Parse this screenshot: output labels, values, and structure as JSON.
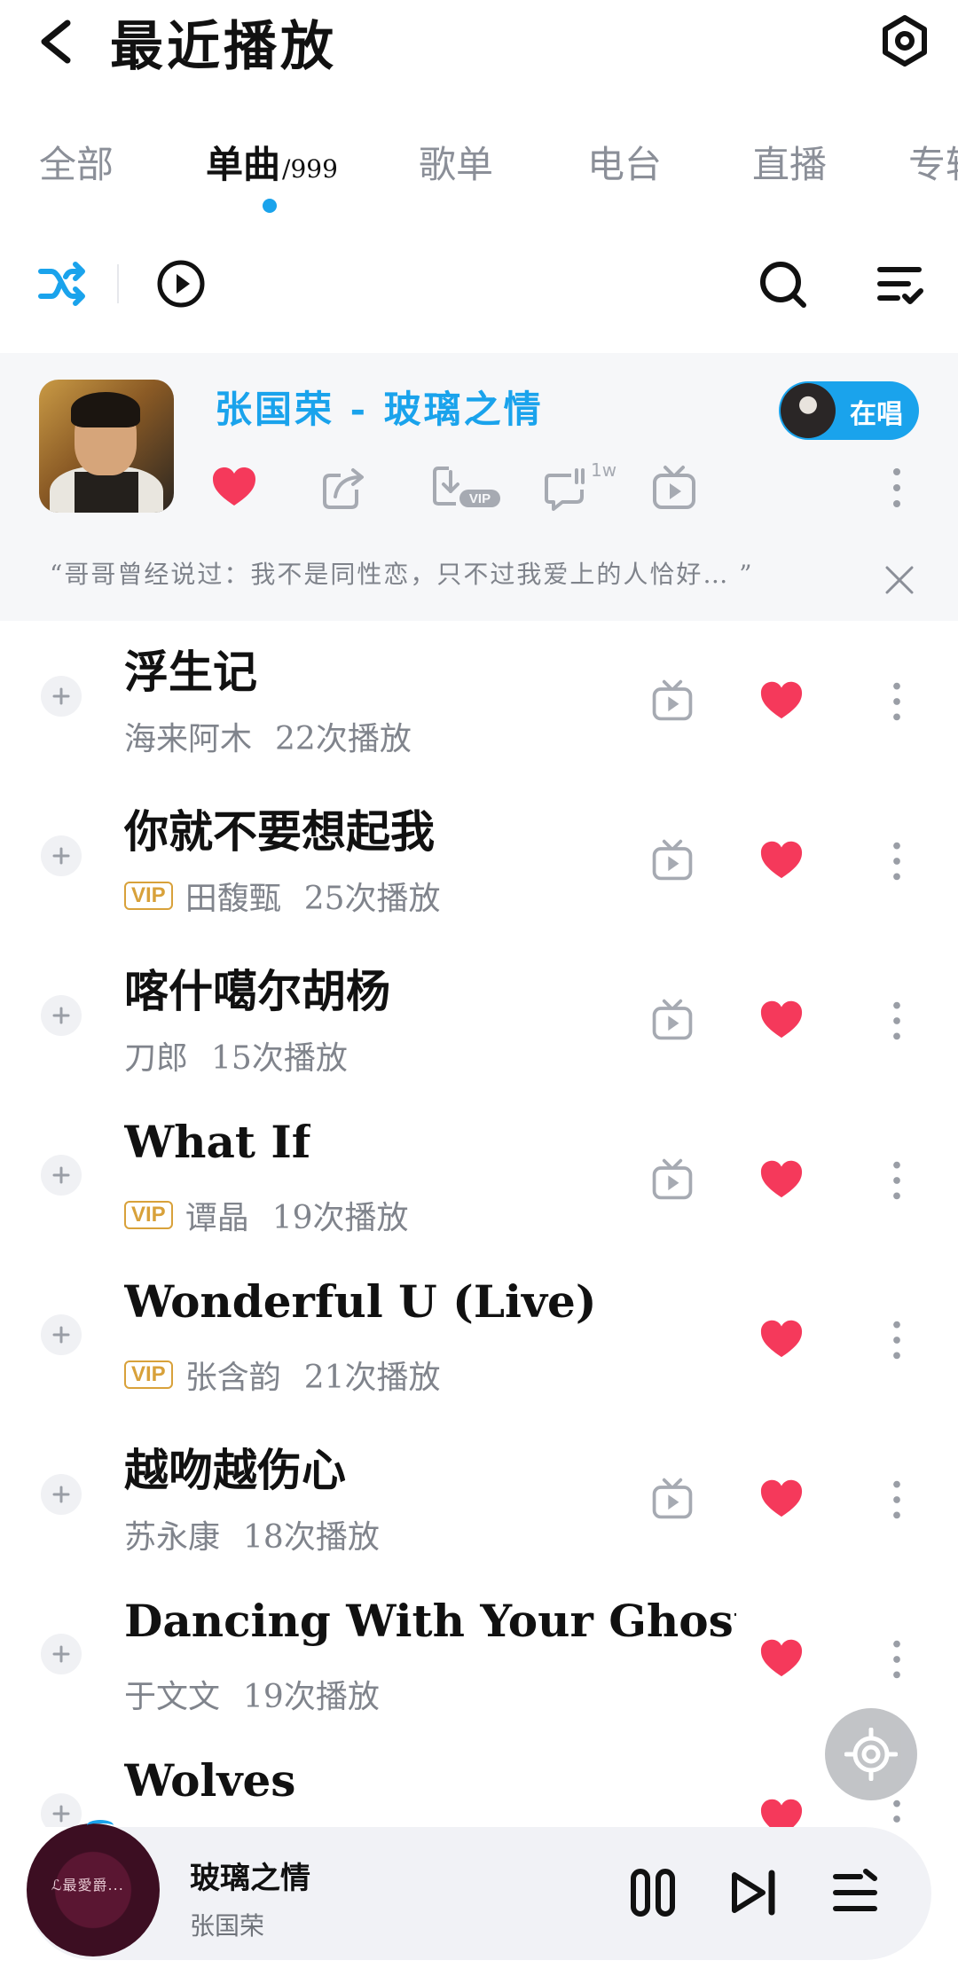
{
  "header": {
    "title": "最近播放"
  },
  "tabs": [
    {
      "label": "全部",
      "sub": ""
    },
    {
      "label": "单曲",
      "sub": "/999"
    },
    {
      "label": "歌单",
      "sub": ""
    },
    {
      "label": "电台",
      "sub": ""
    },
    {
      "label": "直播",
      "sub": ""
    },
    {
      "label": "专辑",
      "sub": ""
    }
  ],
  "now_playing": {
    "title": "张国荣 - 玻璃之情",
    "sing_label": "在唱",
    "quote": "“哥哥曾经说过：我不是同性恋，只不过我爱上的人恰好…  ”",
    "comment_count": "1w"
  },
  "songs": [
    {
      "title": "浮生记",
      "vip": "",
      "artist": "海来阿木",
      "plays": "22次播放",
      "has_mv": true
    },
    {
      "title": "你就不要想起我",
      "vip": "VIP",
      "artist": "田馥甄",
      "plays": "25次播放",
      "has_mv": true
    },
    {
      "title": "喀什噶尔胡杨",
      "vip": "",
      "artist": "刀郎",
      "plays": "15次播放",
      "has_mv": true
    },
    {
      "title": "What If",
      "vip": "VIP",
      "artist": "谭晶",
      "plays": "19次播放",
      "has_mv": true
    },
    {
      "title": "Wonderful U (Live)",
      "vip": "VIP",
      "artist": "张含韵",
      "plays": "21次播放",
      "has_mv": false
    },
    {
      "title": "越吻越伤心",
      "vip": "",
      "artist": "苏永康",
      "plays": "18次播放",
      "has_mv": true
    },
    {
      "title": "Dancing With Your Ghost (…",
      "vip": "",
      "artist": "于文文",
      "plays": "19次播放",
      "has_mv": false
    },
    {
      "title": "Wolves",
      "vip": "",
      "artist": "",
      "plays": "",
      "has_mv": false
    }
  ],
  "player": {
    "title": "玻璃之情",
    "artist": "张国荣",
    "disc_text": "ℒ最愛爵..."
  },
  "colors": {
    "accent": "#1aa3ec",
    "like": "#f5395b",
    "vip": "#d8a13a"
  }
}
